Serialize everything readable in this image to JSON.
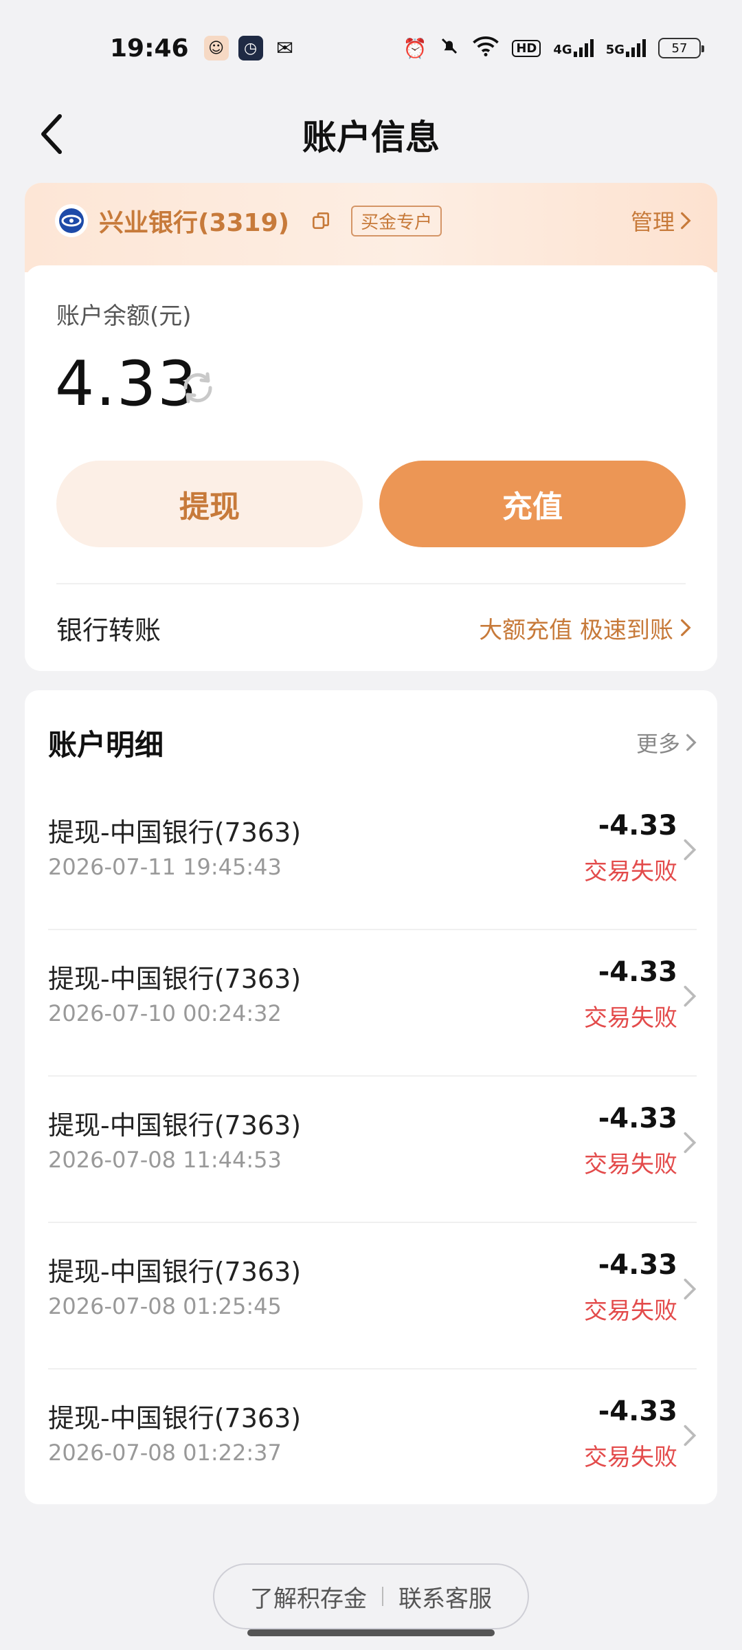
{
  "status_bar": {
    "time": "19:46",
    "net1": "4G",
    "net2": "5G",
    "hd": "HD",
    "battery": "57",
    "icons": [
      "alarm-icon",
      "mute-bell-icon",
      "wifi-icon"
    ]
  },
  "header": {
    "title": "账户信息",
    "back_icon": "chevron-left-icon"
  },
  "account": {
    "bank_name": "兴业银行(3319)",
    "tag": "买金专户",
    "manage_label": "管理",
    "balance_label": "账户余额(元)",
    "balance": "4.33",
    "withdraw_label": "提现",
    "recharge_label": "充值",
    "transfer_label": "银行转账",
    "transfer_promo": "大额充值 极速到账",
    "accent_color": "#c77a3a",
    "primary_color": "#ec9655"
  },
  "details": {
    "title": "账户明细",
    "more_label": "更多",
    "transactions": [
      {
        "title": "提现-中国银行(7363)",
        "time": "2026-07-11 19:45:43",
        "amount": "-4.33",
        "status": "交易失败"
      },
      {
        "title": "提现-中国银行(7363)",
        "time": "2026-07-10 00:24:32",
        "amount": "-4.33",
        "status": "交易失败"
      },
      {
        "title": "提现-中国银行(7363)",
        "time": "2026-07-08 11:44:53",
        "amount": "-4.33",
        "status": "交易失败"
      },
      {
        "title": "提现-中国银行(7363)",
        "time": "2026-07-08 01:25:45",
        "amount": "-4.33",
        "status": "交易失败"
      },
      {
        "title": "提现-中国银行(7363)",
        "time": "2026-07-08 01:22:37",
        "amount": "-4.33",
        "status": "交易失败"
      }
    ]
  },
  "footer": {
    "learn_label": "了解积存金",
    "service_label": "联系客服"
  }
}
